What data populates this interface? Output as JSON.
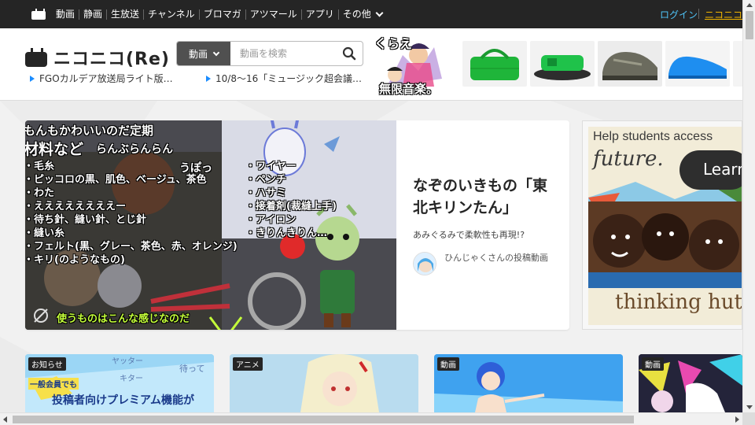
{
  "topbar": {
    "nav": [
      "動画",
      "静画",
      "生放送",
      "チャンネル",
      "ブロマガ",
      "アツマール",
      "アプリ",
      "その他"
    ],
    "login": "ログイン",
    "account": "ニコニコ会員"
  },
  "header": {
    "logo": "ニコニコ(Re)",
    "search_category": "動画",
    "search_placeholder": "動画を検索",
    "news": [
      "FGOカルデア放送局ライト版…",
      "10/8～16「ミュージック超会議…"
    ],
    "promo_text": [
      "くらえ",
      "無限音楽。"
    ]
  },
  "feature": {
    "title": "なぞのいきもの「東北キリンたん」",
    "subtitle": "あみぐるみで柔軟性も再現!?",
    "user": "ひんじゃくさんの投稿動画",
    "overlay_top": "もんもかわいいのだ定期",
    "overlay_materials": "材料など",
    "overlay_ranran": "らんぶらんらん",
    "overlay_left": [
      "・毛糸",
      "・ピッコロの黒、肌色、ベージュ、茶色",
      "・わた",
      "・ええええええええー",
      "・待ち針、縫い針、とじ針",
      "・縫い糸",
      "・フェルト(黒、グレー、茶色、赤、オレンジ)",
      "・キリ(のようなもの)"
    ],
    "overlay_right": [
      "・ワイヤー",
      "・ペンチ",
      "・ハサミ",
      "・接着剤(裁縫上手)",
      "・アイロン",
      "・きりんきりん…"
    ],
    "overlay_bottom": "使うものはこんな感じなのだ",
    "overlay_upo": "うぽっ"
  },
  "side_ad": {
    "line1": "Help students access",
    "line2": "future.",
    "button": "Learn",
    "brand": "thinking huts"
  },
  "cards": [
    {
      "tag": "お知らせ",
      "text1": "一般会員でも",
      "text2": "投稿者向けプレミアム機能が",
      "text3": "待って",
      "text4": "ヤッター",
      "text5": "キター"
    },
    {
      "tag": "アニメ"
    },
    {
      "tag": "動画"
    },
    {
      "tag": "動画"
    }
  ],
  "colors": {
    "topbar": "#252525",
    "login": "#4fc3f7",
    "account": "#f0b400",
    "news_arrow": "#1a8cff"
  }
}
